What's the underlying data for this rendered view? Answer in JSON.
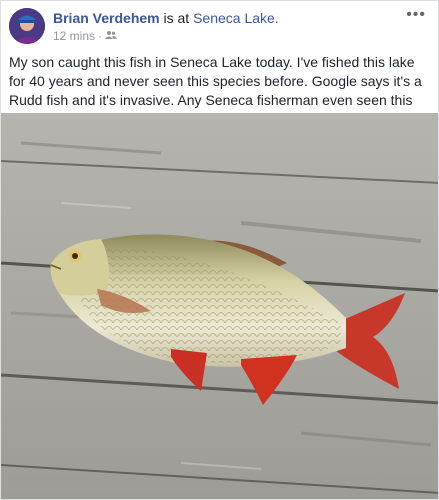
{
  "post": {
    "author": "Brian Verdehem",
    "connector": " is at ",
    "location": "Seneca Lake.",
    "timestamp": "12 mins",
    "separator": "·",
    "audience_icon": "friends-icon",
    "more_icon": "more-options-icon",
    "more_glyph": "•••",
    "body": "My son caught this fish in Seneca Lake today. I've fished this lake for 40 years and never seen this species before. Google says it's a Rudd fish and it's invasive. Any Seneca fisherman even seen this before?"
  },
  "colors": {
    "link": "#385898",
    "text": "#1d2129",
    "meta": "#90949c",
    "fin_red": "#d9301f"
  }
}
